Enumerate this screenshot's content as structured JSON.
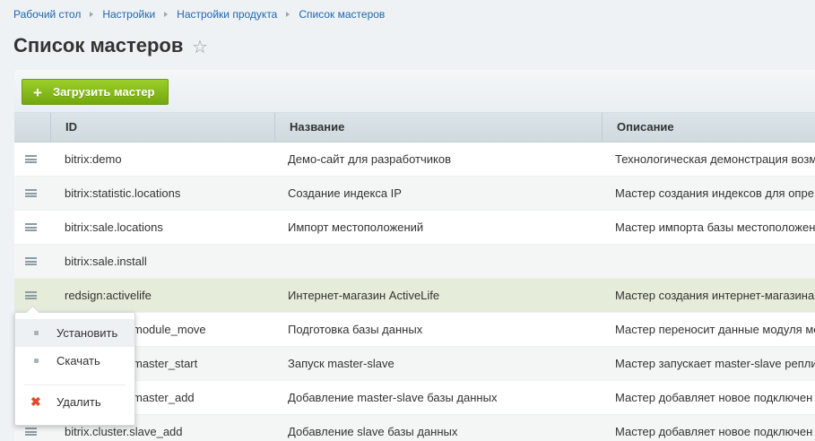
{
  "breadcrumb": [
    "Рабочий стол",
    "Настройки",
    "Настройки продукта",
    "Список мастеров"
  ],
  "page_title": "Список мастеров",
  "toolbar": {
    "upload_label": "Загрузить мастер"
  },
  "table": {
    "headers": {
      "id": "ID",
      "name": "Название",
      "desc": "Описание"
    },
    "rows": [
      {
        "id": "bitrix:demo",
        "name": "Демо-сайт для разработчиков",
        "desc": "Технологическая демонстрация возм"
      },
      {
        "id": "bitrix:statistic.locations",
        "name": "Создание индекса IP",
        "desc": "Мастер создания индексов для опре"
      },
      {
        "id": "bitrix:sale.locations",
        "name": "Импорт местоположений",
        "desc": "Мастер импорта базы местоположен"
      },
      {
        "id": "bitrix:sale.install",
        "name": "",
        "desc": ""
      },
      {
        "id": "redsign:activelife",
        "name": "Интернет-магазин ActiveLife",
        "desc": "Мастер создания интернет-магазина"
      },
      {
        "id": "module_move",
        "name": "Подготовка базы данных",
        "desc": "Мастер переносит данные модуля ме"
      },
      {
        "id": "master_start",
        "name": "Запуск master-slave",
        "desc": "Мастер запускает master-slave репли"
      },
      {
        "id": "master_add",
        "name": "Добавление master-slave базы данных",
        "desc": "Мастер добавляет новое подключен"
      },
      {
        "id": "bitrix.cluster.slave_add",
        "name": "Добавление slave базы данных",
        "desc": "Мастер добавляет новое подключен"
      }
    ]
  },
  "context_menu": {
    "install": "Установить",
    "download": "Скачать",
    "delete": "Удалить"
  },
  "colors": {
    "accent_green": "#7db41a",
    "link_blue": "#2067b0",
    "active_row": "#e5ecd9"
  }
}
